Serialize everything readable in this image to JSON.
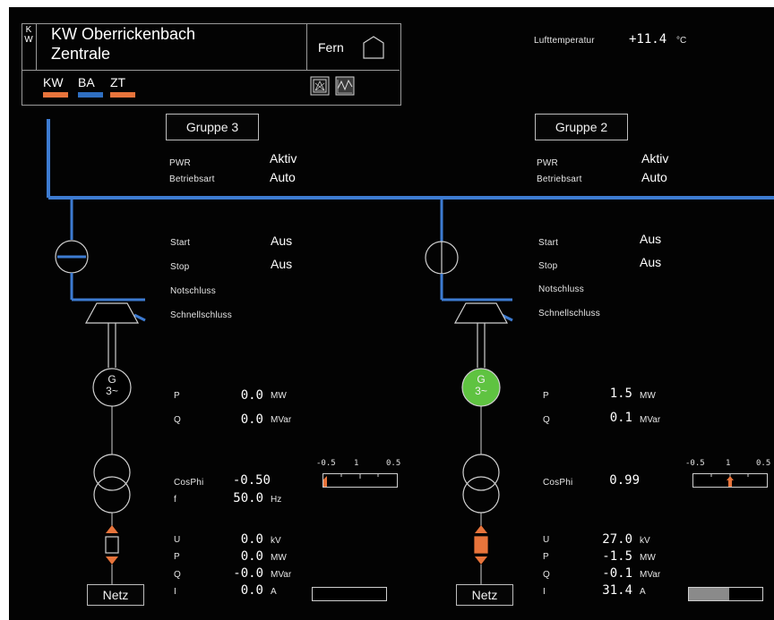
{
  "header": {
    "logo_letters": [
      "K",
      "W"
    ],
    "title_line1": "KW Oberrickenbach",
    "title_line2": "Zentrale",
    "mode_label": "Fern",
    "status_tabs": [
      {
        "label": "KW",
        "color": "#e8743b"
      },
      {
        "label": "BA",
        "color": "#2f6fc2"
      },
      {
        "label": "ZT",
        "color": "#e8743b"
      }
    ]
  },
  "weather": {
    "label": "Lufttemperatur",
    "value": "+11.4",
    "unit": "°C"
  },
  "groups": [
    {
      "name": "Gruppe 3",
      "pwr_label": "PWR",
      "pwr_value": "Aktiv",
      "mode_label": "Betriebsart",
      "mode_value": "Auto",
      "start_label": "Start",
      "start_value": "Aus",
      "stop_label": "Stop",
      "stop_value": "Aus",
      "notschluss_label": "Notschluss",
      "schnellschluss_label": "Schnellschluss",
      "generator_label_1": "G",
      "generator_label_2": "3~",
      "generator_color": "#000000",
      "p_label": "P",
      "p_value": "0.0",
      "p_unit": "MW",
      "q_label": "Q",
      "q_value": "0.0",
      "q_unit": "MVar",
      "cosphi_label": "CosPhi",
      "cosphi_value": "-0.50",
      "f_label": "f",
      "f_value": "50.0",
      "f_unit": "Hz",
      "scale_labels": [
        "-0.5",
        "1",
        "0.5"
      ],
      "cosphi_indicator": 0.0,
      "grid_u_label": "U",
      "grid_u_value": "0.0",
      "grid_u_unit": "kV",
      "grid_p_label": "P",
      "grid_p_value": "0.0",
      "grid_p_unit": "MW",
      "grid_q_label": "Q",
      "grid_q_value": "-0.0",
      "grid_q_unit": "MVar",
      "grid_i_label": "I",
      "grid_i_value": "0.0",
      "grid_i_unit": "A",
      "current_fill": 0.0,
      "breaker_closed": false,
      "netz_label": "Netz"
    },
    {
      "name": "Gruppe 2",
      "pwr_label": "PWR",
      "pwr_value": "Aktiv",
      "mode_label": "Betriebsart",
      "mode_value": "Auto",
      "start_label": "Start",
      "start_value": "Aus",
      "stop_label": "Stop",
      "stop_value": "Aus",
      "notschluss_label": "Notschluss",
      "schnellschluss_label": "Schnellschluss",
      "generator_label_1": "G",
      "generator_label_2": "3~",
      "generator_color": "#5fc341",
      "p_label": "P",
      "p_value": "1.5",
      "p_unit": "MW",
      "q_label": "Q",
      "q_value": "0.1",
      "q_unit": "MVar",
      "cosphi_label": "CosPhi",
      "cosphi_value": "0.99",
      "f_label": "",
      "f_value": "",
      "f_unit": "",
      "scale_labels": [
        "-0.5",
        "1",
        "0.5"
      ],
      "cosphi_indicator": 0.5,
      "grid_u_label": "U",
      "grid_u_value": "27.0",
      "grid_u_unit": "kV",
      "grid_p_label": "P",
      "grid_p_value": "-1.5",
      "grid_p_unit": "MW",
      "grid_q_label": "Q",
      "grid_q_value": "-0.1",
      "grid_q_unit": "MVar",
      "grid_i_label": "I",
      "grid_i_value": "31.4",
      "grid_i_unit": "A",
      "current_fill": 0.55,
      "breaker_closed": true,
      "netz_label": "Netz"
    }
  ],
  "colors": {
    "busbar": "#3d7bd1",
    "arrow": "#e8743b",
    "line": "#9a9a9a"
  }
}
